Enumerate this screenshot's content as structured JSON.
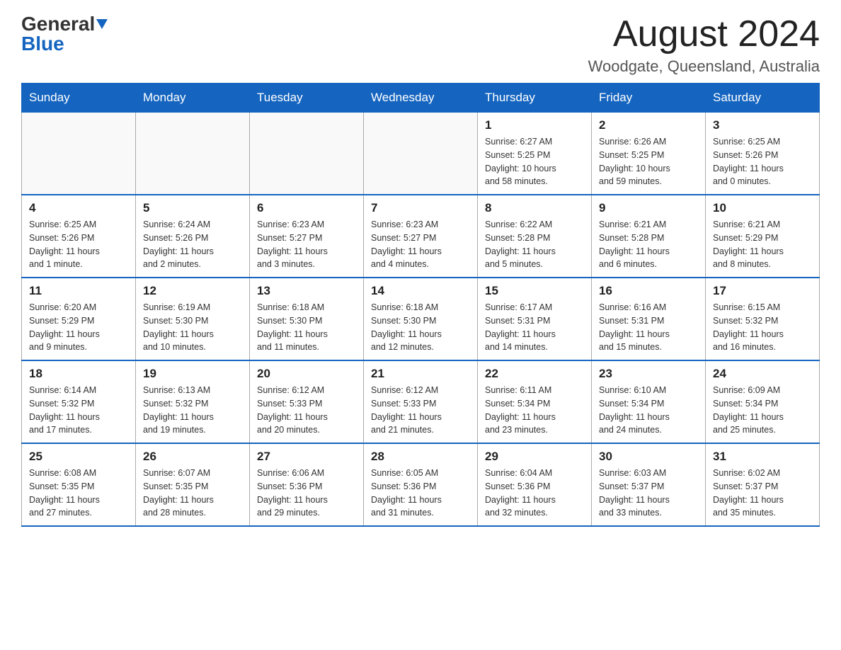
{
  "header": {
    "logo_general": "General",
    "logo_blue": "Blue",
    "month_title": "August 2024",
    "location": "Woodgate, Queensland, Australia"
  },
  "days_of_week": [
    "Sunday",
    "Monday",
    "Tuesday",
    "Wednesday",
    "Thursday",
    "Friday",
    "Saturday"
  ],
  "weeks": [
    [
      {
        "day": "",
        "info": ""
      },
      {
        "day": "",
        "info": ""
      },
      {
        "day": "",
        "info": ""
      },
      {
        "day": "",
        "info": ""
      },
      {
        "day": "1",
        "info": "Sunrise: 6:27 AM\nSunset: 5:25 PM\nDaylight: 10 hours\nand 58 minutes."
      },
      {
        "day": "2",
        "info": "Sunrise: 6:26 AM\nSunset: 5:25 PM\nDaylight: 10 hours\nand 59 minutes."
      },
      {
        "day": "3",
        "info": "Sunrise: 6:25 AM\nSunset: 5:26 PM\nDaylight: 11 hours\nand 0 minutes."
      }
    ],
    [
      {
        "day": "4",
        "info": "Sunrise: 6:25 AM\nSunset: 5:26 PM\nDaylight: 11 hours\nand 1 minute."
      },
      {
        "day": "5",
        "info": "Sunrise: 6:24 AM\nSunset: 5:26 PM\nDaylight: 11 hours\nand 2 minutes."
      },
      {
        "day": "6",
        "info": "Sunrise: 6:23 AM\nSunset: 5:27 PM\nDaylight: 11 hours\nand 3 minutes."
      },
      {
        "day": "7",
        "info": "Sunrise: 6:23 AM\nSunset: 5:27 PM\nDaylight: 11 hours\nand 4 minutes."
      },
      {
        "day": "8",
        "info": "Sunrise: 6:22 AM\nSunset: 5:28 PM\nDaylight: 11 hours\nand 5 minutes."
      },
      {
        "day": "9",
        "info": "Sunrise: 6:21 AM\nSunset: 5:28 PM\nDaylight: 11 hours\nand 6 minutes."
      },
      {
        "day": "10",
        "info": "Sunrise: 6:21 AM\nSunset: 5:29 PM\nDaylight: 11 hours\nand 8 minutes."
      }
    ],
    [
      {
        "day": "11",
        "info": "Sunrise: 6:20 AM\nSunset: 5:29 PM\nDaylight: 11 hours\nand 9 minutes."
      },
      {
        "day": "12",
        "info": "Sunrise: 6:19 AM\nSunset: 5:30 PM\nDaylight: 11 hours\nand 10 minutes."
      },
      {
        "day": "13",
        "info": "Sunrise: 6:18 AM\nSunset: 5:30 PM\nDaylight: 11 hours\nand 11 minutes."
      },
      {
        "day": "14",
        "info": "Sunrise: 6:18 AM\nSunset: 5:30 PM\nDaylight: 11 hours\nand 12 minutes."
      },
      {
        "day": "15",
        "info": "Sunrise: 6:17 AM\nSunset: 5:31 PM\nDaylight: 11 hours\nand 14 minutes."
      },
      {
        "day": "16",
        "info": "Sunrise: 6:16 AM\nSunset: 5:31 PM\nDaylight: 11 hours\nand 15 minutes."
      },
      {
        "day": "17",
        "info": "Sunrise: 6:15 AM\nSunset: 5:32 PM\nDaylight: 11 hours\nand 16 minutes."
      }
    ],
    [
      {
        "day": "18",
        "info": "Sunrise: 6:14 AM\nSunset: 5:32 PM\nDaylight: 11 hours\nand 17 minutes."
      },
      {
        "day": "19",
        "info": "Sunrise: 6:13 AM\nSunset: 5:32 PM\nDaylight: 11 hours\nand 19 minutes."
      },
      {
        "day": "20",
        "info": "Sunrise: 6:12 AM\nSunset: 5:33 PM\nDaylight: 11 hours\nand 20 minutes."
      },
      {
        "day": "21",
        "info": "Sunrise: 6:12 AM\nSunset: 5:33 PM\nDaylight: 11 hours\nand 21 minutes."
      },
      {
        "day": "22",
        "info": "Sunrise: 6:11 AM\nSunset: 5:34 PM\nDaylight: 11 hours\nand 23 minutes."
      },
      {
        "day": "23",
        "info": "Sunrise: 6:10 AM\nSunset: 5:34 PM\nDaylight: 11 hours\nand 24 minutes."
      },
      {
        "day": "24",
        "info": "Sunrise: 6:09 AM\nSunset: 5:34 PM\nDaylight: 11 hours\nand 25 minutes."
      }
    ],
    [
      {
        "day": "25",
        "info": "Sunrise: 6:08 AM\nSunset: 5:35 PM\nDaylight: 11 hours\nand 27 minutes."
      },
      {
        "day": "26",
        "info": "Sunrise: 6:07 AM\nSunset: 5:35 PM\nDaylight: 11 hours\nand 28 minutes."
      },
      {
        "day": "27",
        "info": "Sunrise: 6:06 AM\nSunset: 5:36 PM\nDaylight: 11 hours\nand 29 minutes."
      },
      {
        "day": "28",
        "info": "Sunrise: 6:05 AM\nSunset: 5:36 PM\nDaylight: 11 hours\nand 31 minutes."
      },
      {
        "day": "29",
        "info": "Sunrise: 6:04 AM\nSunset: 5:36 PM\nDaylight: 11 hours\nand 32 minutes."
      },
      {
        "day": "30",
        "info": "Sunrise: 6:03 AM\nSunset: 5:37 PM\nDaylight: 11 hours\nand 33 minutes."
      },
      {
        "day": "31",
        "info": "Sunrise: 6:02 AM\nSunset: 5:37 PM\nDaylight: 11 hours\nand 35 minutes."
      }
    ]
  ]
}
